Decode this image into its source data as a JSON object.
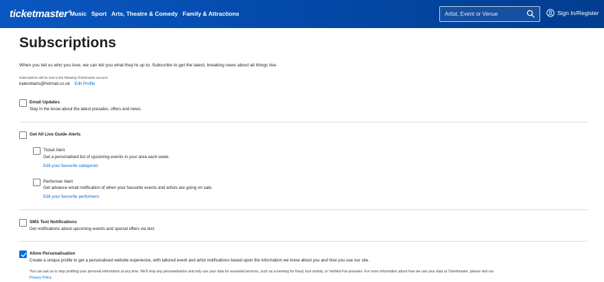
{
  "header": {
    "logo": "ticketmaster",
    "logo_mark": "®",
    "nav": [
      "Music",
      "Sport",
      "Arts, Theatre & Comedy",
      "Family & Attractions"
    ],
    "search_placeholder": "Artist, Event or Venue",
    "signin_label": "Sign In/Register",
    "search_icon": "search-icon",
    "user_icon": "user-icon"
  },
  "page": {
    "title": "Subscriptions",
    "intro": "When you tell us who you love, we can tell you what they're up to. Subscribe to get the latest, breaking news about all things live.",
    "account_note": "Subscriptions will be sent to the following Ticketmaster account:",
    "email": "katerobarts@hotmail.co.uk",
    "edit_profile": "Edit Profile"
  },
  "options": {
    "email_updates": {
      "title": "Email Updates",
      "desc": "Stay in the know about the latest presales, offers and news.",
      "checked": false
    },
    "live_guide": {
      "title": "Get All Live Guide Alerts",
      "checked": false
    },
    "ticket_alert": {
      "title": "Ticket Alert",
      "desc": "Get a personalised list of upcoming events in your area each week.",
      "link": "Edit your favourite categories",
      "checked": false
    },
    "performer_alert": {
      "title": "Performer Alert",
      "desc": "Get advance email notification of when your favourite events and artists are going on sale.",
      "link": "Edit your favourite performers",
      "checked": false
    },
    "sms": {
      "title": "SMS Text Notifications",
      "desc": "Get notifications about upcoming events and special offers via text.",
      "checked": false
    },
    "personalisation": {
      "title": "Allow Personalisation",
      "desc": "Create a unique profile to get a personalised website experience, with tailored event and artist notifications based upon the information we know about you and how you use our site.",
      "checked": true
    }
  },
  "fineprint": {
    "text": "You can ask us to stop profiling your personal information at any time. We'll stop any personalisation and only use your data for essential services, such as screening for fraud, tout activity, or Verified Fan presales. For more information about how we use your data at Ticketmaster, please visit our",
    "link": "Privacy Policy"
  },
  "colors": {
    "header_blue": "#0348a6",
    "link_blue": "#026cdf",
    "checkbox_checked": "#026cdf"
  }
}
